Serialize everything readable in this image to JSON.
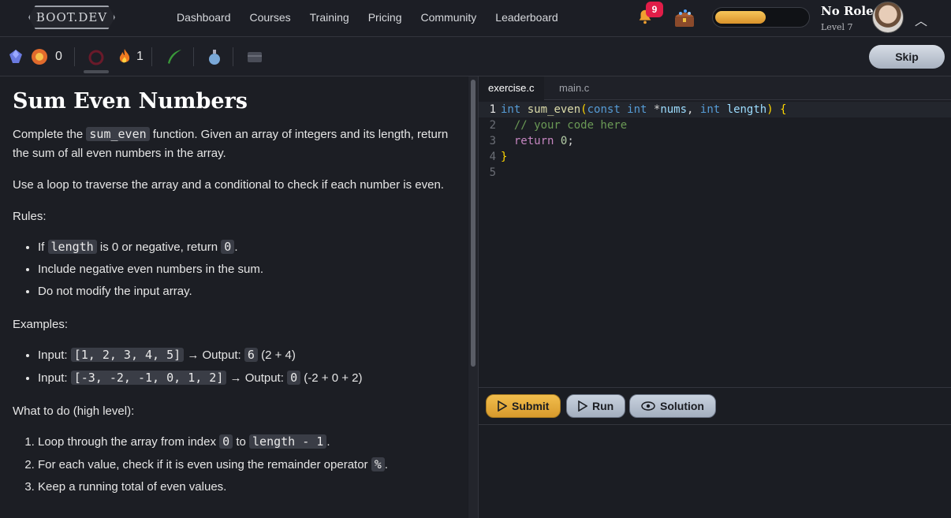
{
  "nav": {
    "logo": "BOOT.DEV",
    "links": [
      "Dashboard",
      "Courses",
      "Training",
      "Pricing",
      "Community",
      "Leaderboard"
    ],
    "notifications": "9",
    "xp_progress": 0.55,
    "user": {
      "name": "No Role",
      "level": "Level 7"
    }
  },
  "toolbar": {
    "gems_count": "0",
    "flame_count": "1",
    "skip_label": "Skip"
  },
  "lesson": {
    "title": "Sum Even Numbers",
    "p1_pre": "Complete the ",
    "p1_code": "sum_even",
    "p1_post": " function. Given an array of integers and its length, return the sum of all even numbers in the array.",
    "p2": "Use a loop to traverse the array and a conditional to check if each number is even.",
    "rules_label": "Rules:",
    "rules": {
      "r1_pre": "If ",
      "r1_code1": "length",
      "r1_mid": " is 0 or negative, return ",
      "r1_code2": "0",
      "r1_post": ".",
      "r2": "Include negative even numbers in the sum.",
      "r3": "Do not modify the input array."
    },
    "examples_label": "Examples:",
    "examples": {
      "e1_pre": "Input: ",
      "e1_in": "[1, 2, 3, 4, 5]",
      "e1_mid": " → Output: ",
      "e1_out": "6",
      "e1_post": " (2 + 4)",
      "e2_pre": "Input: ",
      "e2_in": "[-3, -2, -1, 0, 1, 2]",
      "e2_mid": " → Output: ",
      "e2_out": "0",
      "e2_post": " (-2 + 0 + 2)"
    },
    "todo_label": "What to do (high level):",
    "steps": {
      "s1_pre": "Loop through the array from index ",
      "s1_code1": "0",
      "s1_mid": " to ",
      "s1_code2": "length - 1",
      "s1_post": ".",
      "s2_pre": "For each value, check if it is even using the remainder operator ",
      "s2_code": "%",
      "s2_post": ".",
      "s3": "Keep a running total of even values."
    }
  },
  "editor": {
    "tabs": [
      "exercise.c",
      "main.c"
    ],
    "line_numbers": [
      "1",
      "2",
      "3",
      "4",
      "5"
    ],
    "code": {
      "l1_kw1": "int",
      "l1_fn": "sum_even",
      "l1_p1": "(",
      "l1_kw2": "const int",
      "l1_star": " *",
      "l1_id1": "nums",
      "l1_comma": ", ",
      "l1_kw3": "int",
      "l1_id2": "length",
      "l1_p2": ") ",
      "l1_brace": "{",
      "l2_comment": "// your code here",
      "l3_ret": "return",
      "l3_num": "0",
      "l3_semi": ";",
      "l4_brace": "}"
    },
    "buttons": {
      "submit": "Submit",
      "run": "Run",
      "solution": "Solution"
    }
  },
  "colors": {
    "accent": "#f2be4d",
    "bg": "#1a1c23"
  }
}
